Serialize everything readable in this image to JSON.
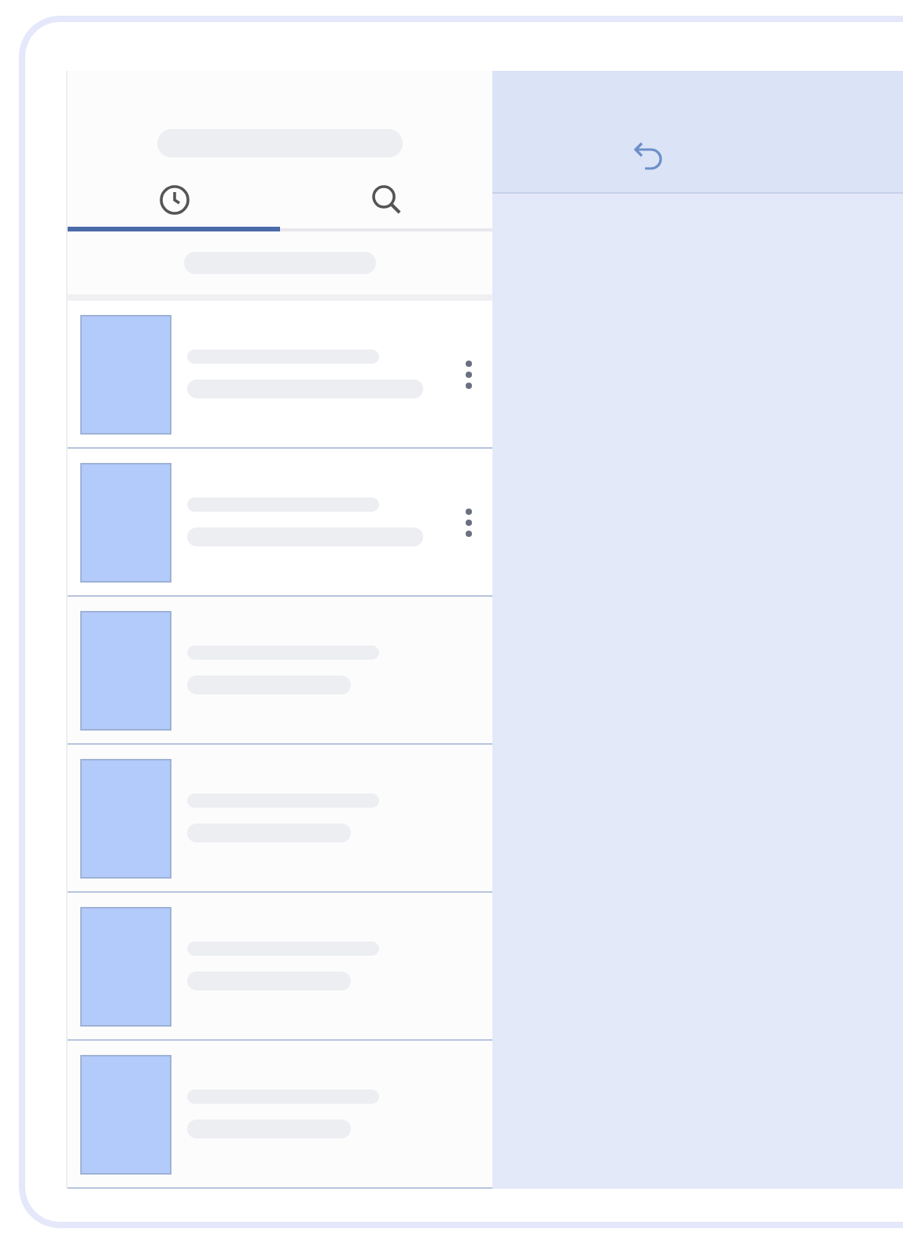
{
  "tabs": [
    {
      "kind": "clock",
      "selected": true
    },
    {
      "kind": "search",
      "selected": false
    }
  ],
  "items": [
    {
      "menu": true
    },
    {
      "menu": true
    },
    {
      "menu": false
    },
    {
      "menu": false
    },
    {
      "menu": false
    },
    {
      "menu": false
    }
  ]
}
